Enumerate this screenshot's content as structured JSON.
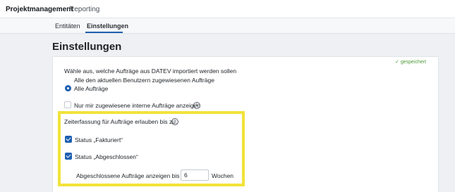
{
  "topnav": {
    "items": [
      "Projektmanagement",
      "Reporting"
    ],
    "active": "Projektmanagement"
  },
  "subnav": {
    "tabs": [
      "Entitäten",
      "Einstellungen"
    ],
    "active": "Einstellungen"
  },
  "page": {
    "title": "Einstellungen",
    "saved_status": "gespeichert"
  },
  "import_section": {
    "heading": "Wähle aus, welche Aufträge aus DATEV importiert werden sollen",
    "options": [
      "Alle den aktuellen Benutzern zugewiesenen Aufträge",
      "Alle Aufträge"
    ],
    "selected": "Alle Aufträge"
  },
  "internal_orders": {
    "label": "Nur mir zugewiesene interne Aufträge anzeigen",
    "checked": false
  },
  "time_entry": {
    "heading": "Zeiterfassung für Aufträge erlauben bis zu:",
    "status_invoiced": {
      "label": "Status „Fakturiert“",
      "checked": true
    },
    "status_closed": {
      "label": "Status „Abgeschlossen“",
      "checked": true
    },
    "closed_weeks": {
      "prefix": "Abgeschlossene Aufträge anzeigen bis zu",
      "value": "6",
      "suffix": "Wochen"
    }
  },
  "colors": {
    "accent": "#1f5fb0",
    "highlight": "#f2e33a",
    "success": "#4d9a3a"
  },
  "icons": {
    "saved": "check-icon",
    "info": "info-icon"
  }
}
